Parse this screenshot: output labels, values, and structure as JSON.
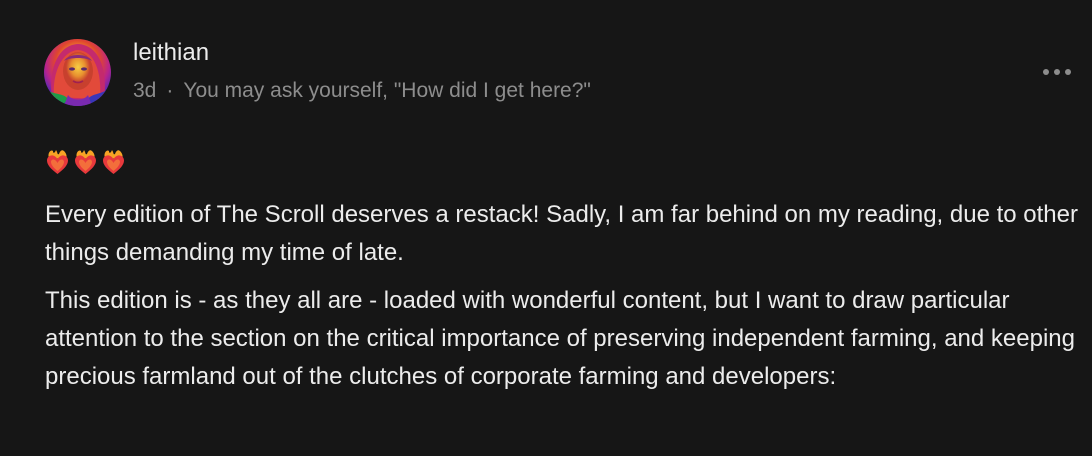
{
  "author": {
    "name": "leithian",
    "avatar_alt": "avatar"
  },
  "meta": {
    "age": "3d",
    "separator": "·",
    "tagline": "You may ask yourself, \"How did I get here?\""
  },
  "menu": {
    "icon": "more-horizontal-icon"
  },
  "emojis": [
    "heart-on-fire-icon",
    "heart-on-fire-icon",
    "heart-on-fire-icon"
  ],
  "paragraphs": [
    "Every edition of The Scroll deserves a restack! Sadly, I am far behind on my reading, due to other things demanding my time of late.",
    "This edition is - as they all are - loaded with wonderful content, but I want to draw particular attention to the section on the critical importance of preserving independent farming, and keeping precious farmland out of the clutches of corporate farming and developers:"
  ],
  "colors": {
    "background": "#161616",
    "text": "#ececec",
    "muted": "#8d8d8d"
  }
}
